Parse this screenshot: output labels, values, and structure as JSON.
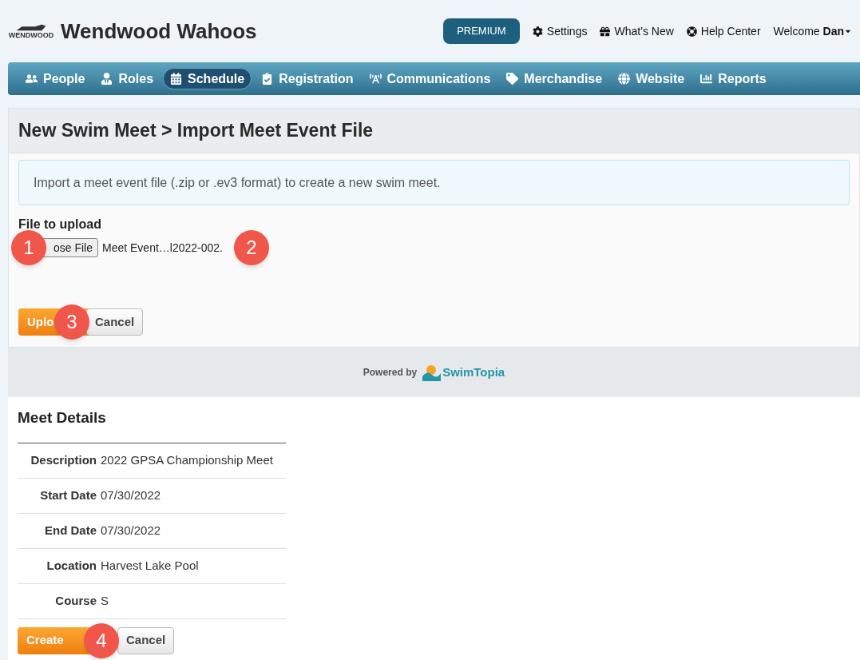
{
  "header": {
    "logo_text": "WENDWOOD",
    "team_name": "Wendwood Wahoos",
    "premium_button": "PREMIUM",
    "links": [
      "Settings",
      "What’s New",
      "Help Center"
    ],
    "welcome": {
      "prefix": "Welcome",
      "user": "Dan"
    }
  },
  "nav": [
    {
      "label": "People",
      "selected": false
    },
    {
      "label": "Roles",
      "selected": false
    },
    {
      "label": "Schedule",
      "selected": true
    },
    {
      "label": "Registration",
      "selected": false
    },
    {
      "label": "Communications",
      "selected": false
    },
    {
      "label": "Merchandise",
      "selected": false
    },
    {
      "label": "Website",
      "selected": false
    },
    {
      "label": "Reports",
      "selected": false
    }
  ],
  "page_title": "New Swim Meet > Import Meet Event File",
  "info_alert": "Import a meet event file (.zip or .ev3 format) to create a new swim meet.",
  "upload": {
    "label": "File to upload",
    "choose_button": "ose File",
    "file_name": "Meet Event…l2022-002.",
    "upload_button": "Uplo",
    "cancel_button": "Cancel"
  },
  "footer": {
    "powered_by": "Powered by",
    "brand": "SwimTopia"
  },
  "meet_details": {
    "title": "Meet Details",
    "rows": [
      {
        "label": "Description",
        "value": "2022 GPSA Championship Meet"
      },
      {
        "label": "Start Date",
        "value": "07/30/2022"
      },
      {
        "label": "End Date",
        "value": "07/30/2022"
      },
      {
        "label": "Location",
        "value": "Harvest Lake Pool"
      },
      {
        "label": "Course",
        "value": "S"
      }
    ],
    "create_button": "Create",
    "cancel_button": "Cancel"
  },
  "callouts": [
    "1",
    "2",
    "3",
    "4"
  ]
}
